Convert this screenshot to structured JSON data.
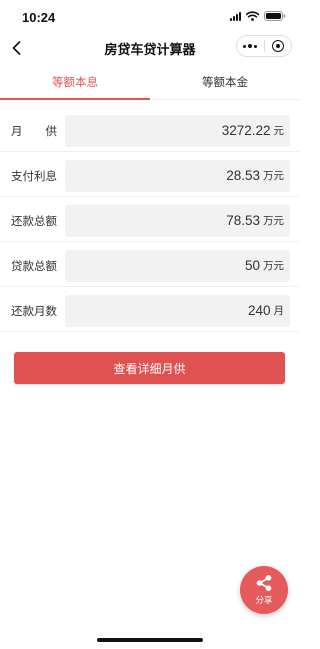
{
  "status_bar": {
    "time": "10:24"
  },
  "nav": {
    "title": "房贷车贷计算器"
  },
  "tabs": [
    {
      "label": "等额本息",
      "active": true
    },
    {
      "label": "等额本金",
      "active": false
    }
  ],
  "rows": [
    {
      "label": "月　　供",
      "label_chars": [
        "月",
        "供"
      ],
      "value": "3272.22",
      "unit": "元"
    },
    {
      "label": "支付利息",
      "value": "28.53",
      "unit": "万元"
    },
    {
      "label": "还款总额",
      "value": "78.53",
      "unit": "万元"
    },
    {
      "label": "贷款总额",
      "value": "50",
      "unit": "万元"
    },
    {
      "label": "还款月数",
      "value": "240",
      "unit": "月"
    }
  ],
  "button": {
    "label": "查看详细月供"
  },
  "share": {
    "label": "分享"
  },
  "colors": {
    "accent": "#e05555",
    "button": "#e05252",
    "field_bg": "#f2f2f2"
  }
}
